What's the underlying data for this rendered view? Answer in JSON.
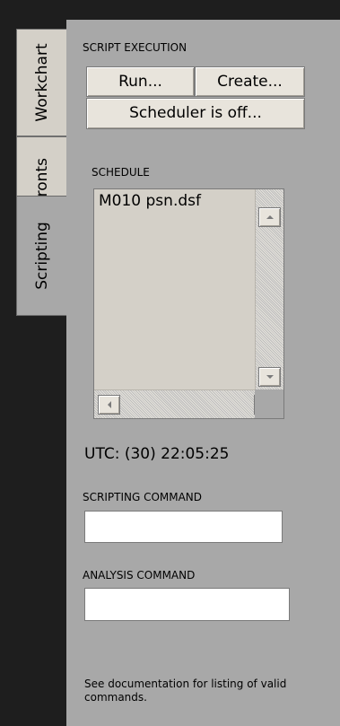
{
  "tabs": [
    {
      "label": "Workchart"
    },
    {
      "label": "Fronts"
    },
    {
      "label": "Scripting"
    }
  ],
  "script_execution": {
    "title": "SCRIPT EXECUTION",
    "run_label": "Run...",
    "create_label": "Create...",
    "scheduler_label": "Scheduler is off..."
  },
  "schedule": {
    "title": "SCHEDULE",
    "items": [
      "M010 psn.dsf"
    ]
  },
  "utc": {
    "text": "UTC: (30) 22:05:25"
  },
  "scripting_command": {
    "title": "SCRIPTING COMMAND",
    "value": ""
  },
  "analysis_command": {
    "title": "ANALYSIS COMMAND",
    "value": ""
  },
  "help": {
    "text": "See documentation for listing of valid commands."
  },
  "icons": {
    "scroll_up": "arrow-up-icon",
    "scroll_down": "arrow-down-icon",
    "scroll_left": "arrow-left-icon",
    "scroll_right": "arrow-right-icon"
  },
  "colors": {
    "panel_bg": "#a8a8a8",
    "frame_bg": "#1e1e1e",
    "control_bg": "#d4d0c8",
    "input_bg": "#ffffff"
  }
}
